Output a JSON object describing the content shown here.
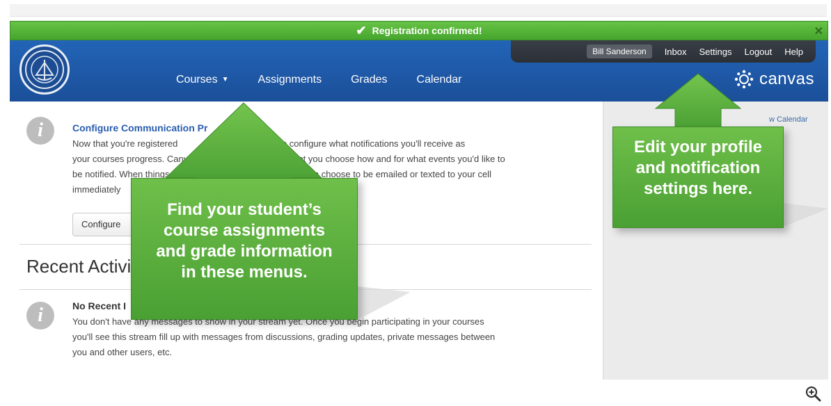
{
  "banner": {
    "message": "Registration confirmed!",
    "check_glyph": "✔",
    "close_glyph": "✕"
  },
  "util_nav": {
    "user_name": "Bill Sanderson",
    "inbox": "Inbox",
    "settings": "Settings",
    "logout": "Logout",
    "help": "Help"
  },
  "main_nav": {
    "courses": "Courses",
    "assignments": "Assignments",
    "grades": "Grades",
    "calendar": "Calendar"
  },
  "brand": {
    "name": "canvas"
  },
  "notice": {
    "title": "Configure Communication Pr",
    "lines": [
      "Now that you're registered",
      "might want to configure what notifications you'll receive as",
      "your courses progress. Canva",
      "enough to let you choose how and for what events you'd like to",
      "be notified. When things happ",
      "ourses you can choose to be emailed or texted to your cell",
      "immediately"
    ],
    "button": "Configure"
  },
  "recent": {
    "title": "Recent Activi",
    "item_title": "No Recent I",
    "line1a": "You don't have any messages to show in your stream yet. Once you begin participating in your courses",
    "line2": "you'll see this stream fill up with messages from discussions, grading updates, private messages between",
    "line3": "you and other users, etc."
  },
  "sidebar": {
    "calendar_link": "w Calendar"
  },
  "callouts": {
    "left": [
      "Find your student’s",
      "course assignments",
      "and grade information",
      "in these menus."
    ],
    "right": [
      "Edit your profile",
      "and notification",
      "settings here."
    ]
  },
  "colors": {
    "banner_green": "#45a52d",
    "header_blue": "#1b4f99",
    "callout_green": "#5cb33e"
  },
  "icons": {
    "info": "info-icon",
    "zoom": "zoom-in-icon",
    "seal": "school-seal-icon",
    "brand": "canvas-logo-icon"
  }
}
